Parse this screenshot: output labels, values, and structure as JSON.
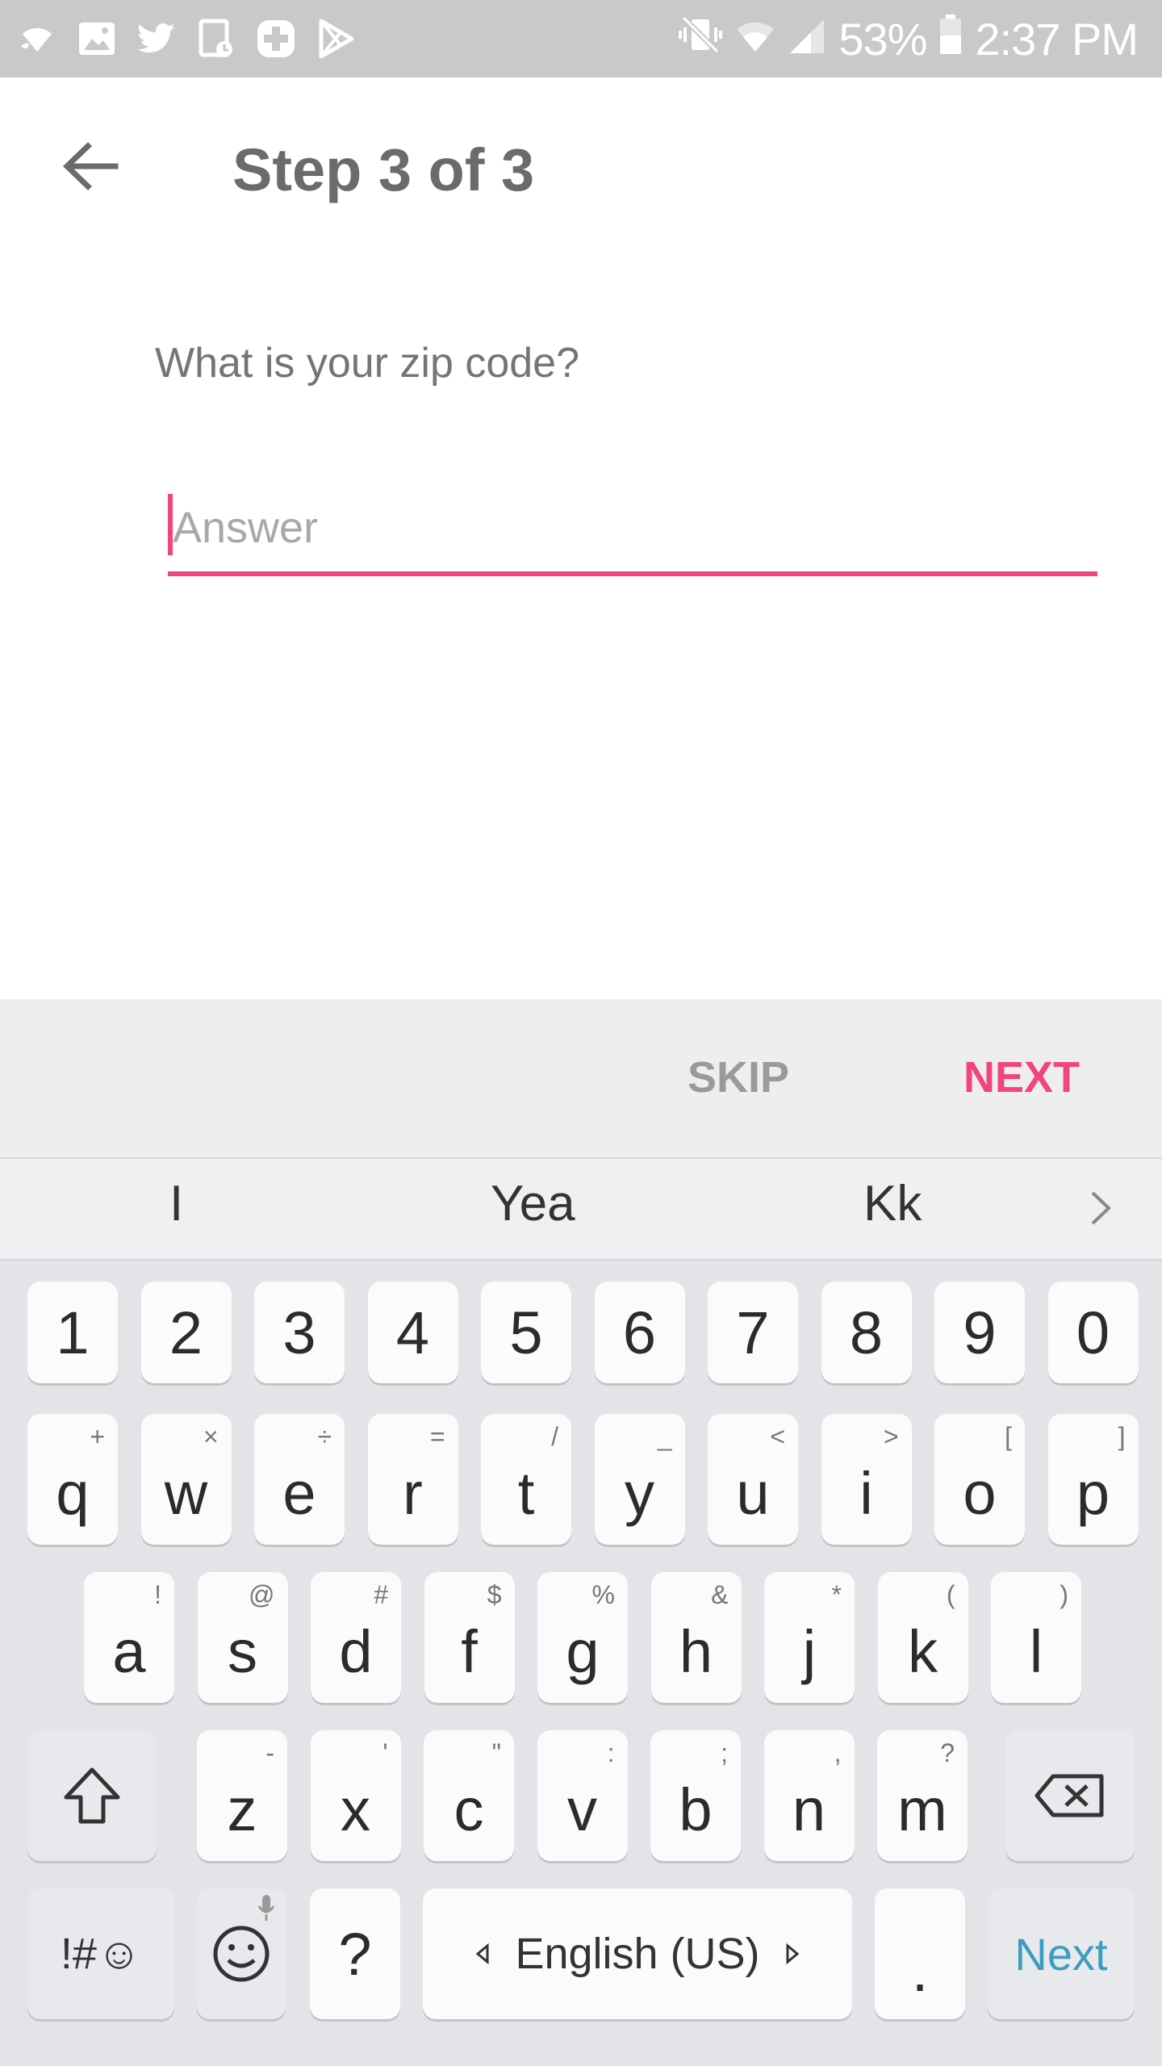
{
  "status_bar": {
    "battery": "53%",
    "time": "2:37 PM",
    "left_icons": [
      "wifi-calling-icon",
      "image-icon",
      "twitter-icon",
      "calendar-icon",
      "medical-plus-icon",
      "play-store-icon"
    ],
    "right_icons": [
      "mute-vibrate-icon",
      "wifi-icon",
      "signal-icon",
      "battery-icon"
    ]
  },
  "header": {
    "title": "Step 3 of 3"
  },
  "form": {
    "question": "What is your zip code?",
    "answer_placeholder": "Answer",
    "answer_value": ""
  },
  "actions": {
    "skip": "SKIP",
    "next": "NEXT"
  },
  "colors": {
    "accent": "#f2457f",
    "status_bar": "#c9c9c9",
    "keyboard_bg": "#e3e4e8"
  },
  "keyboard": {
    "suggestions": [
      "I",
      "Yea",
      "Kk"
    ],
    "number_row": [
      "1",
      "2",
      "3",
      "4",
      "5",
      "6",
      "7",
      "8",
      "9",
      "0"
    ],
    "row1": [
      {
        "key": "q",
        "sub": "+"
      },
      {
        "key": "w",
        "sub": "×"
      },
      {
        "key": "e",
        "sub": "÷"
      },
      {
        "key": "r",
        "sub": "="
      },
      {
        "key": "t",
        "sub": "/"
      },
      {
        "key": "y",
        "sub": "_"
      },
      {
        "key": "u",
        "sub": "<"
      },
      {
        "key": "i",
        "sub": ">"
      },
      {
        "key": "o",
        "sub": "["
      },
      {
        "key": "p",
        "sub": "]"
      }
    ],
    "row2": [
      {
        "key": "a",
        "sub": "!"
      },
      {
        "key": "s",
        "sub": "@"
      },
      {
        "key": "d",
        "sub": "#"
      },
      {
        "key": "f",
        "sub": "$"
      },
      {
        "key": "g",
        "sub": "%"
      },
      {
        "key": "h",
        "sub": "&"
      },
      {
        "key": "j",
        "sub": "*"
      },
      {
        "key": "k",
        "sub": "("
      },
      {
        "key": "l",
        "sub": ")"
      }
    ],
    "row3": [
      {
        "key": "z",
        "sub": "-"
      },
      {
        "key": "x",
        "sub": "'"
      },
      {
        "key": "c",
        "sub": "\""
      },
      {
        "key": "v",
        "sub": ":"
      },
      {
        "key": "b",
        "sub": ";"
      },
      {
        "key": "n",
        "sub": ","
      },
      {
        "key": "m",
        "sub": "?"
      }
    ],
    "symbols_key": "!#☺",
    "question_key": "?",
    "space_label": "English (US)",
    "period_key": ".",
    "action_key": "Next"
  }
}
